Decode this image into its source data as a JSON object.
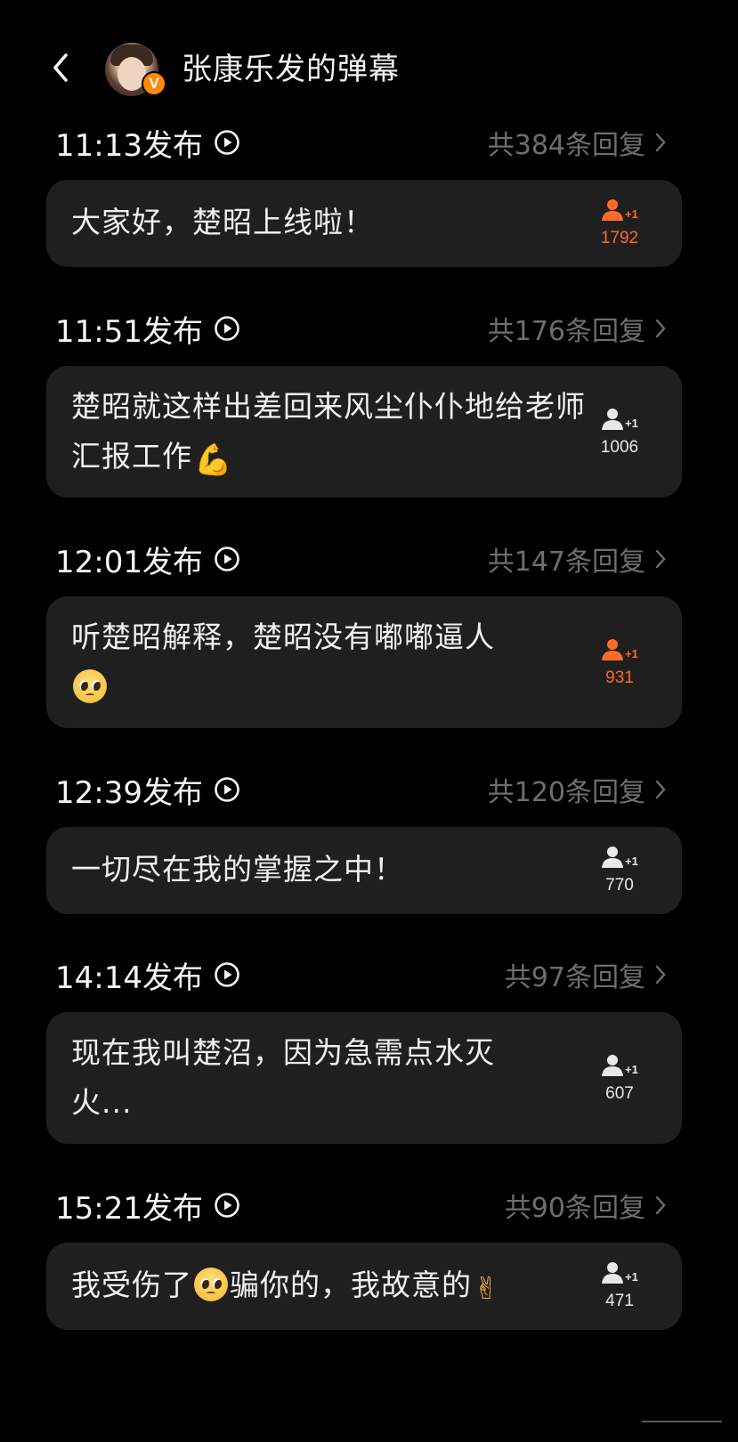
{
  "header": {
    "title": "张康乐发的弹幕",
    "back_icon": "chevron-left-icon",
    "verified_badge": "V"
  },
  "colors": {
    "background": "#000000",
    "card": "#1f1f1f",
    "accent_orange": "#ff6a2b",
    "muted_text": "#6e6e6e"
  },
  "danmaku": [
    {
      "time": "11:13发布",
      "replies": "共384条回复",
      "text_parts": [
        "大家好，楚昭上线啦！"
      ],
      "plus_count": "1792",
      "highlighted": true
    },
    {
      "time": "11:51发布",
      "replies": "共176条回复",
      "text_parts": [
        "楚昭就这样出差回来风尘仆仆地给老师汇报工作"
      ],
      "emoji": "💪",
      "plus_count": "1006",
      "highlighted": false
    },
    {
      "time": "12:01发布",
      "replies": "共147条回复",
      "text_parts": [
        "听楚昭解释，楚昭没有嘟嘟逼人"
      ],
      "emoji": "🥺",
      "plus_count": "931",
      "highlighted": true
    },
    {
      "time": "12:39发布",
      "replies": "共120条回复",
      "text_parts": [
        "一切尽在我的掌握之中！"
      ],
      "plus_count": "770",
      "highlighted": false
    },
    {
      "time": "14:14发布",
      "replies": "共97条回复",
      "text_parts": [
        "现在我叫楚沼，因为急需点水灭火..."
      ],
      "plus_count": "607",
      "highlighted": false
    },
    {
      "time": "15:21发布",
      "replies": "共90条回复",
      "text_before": "我受伤了",
      "emoji": "🥺",
      "text_after": "骗你的，我故意的",
      "emoji2": "✌",
      "plus_count": "471",
      "highlighted": false
    }
  ]
}
